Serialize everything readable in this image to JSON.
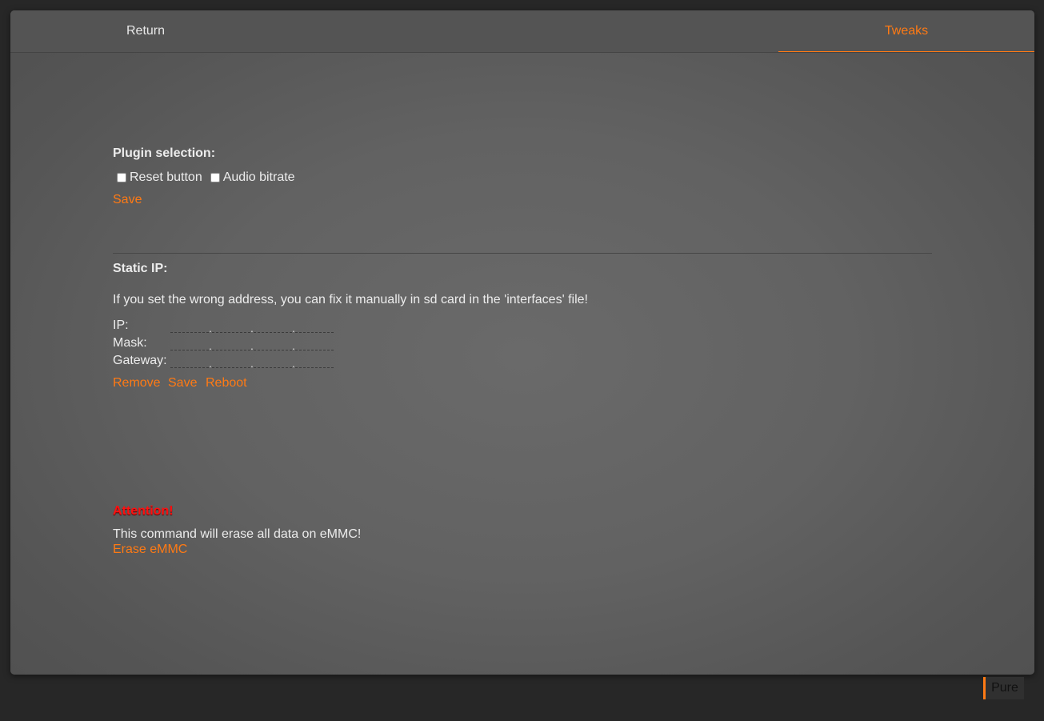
{
  "nav": {
    "return_label": "Return",
    "tweaks_label": "Tweaks"
  },
  "plugins": {
    "title": "Plugin selection:",
    "options": [
      "Reset button",
      "Audio bitrate"
    ],
    "save_label": "Save"
  },
  "static_ip": {
    "title": "Static IP:",
    "note": "If you set the wrong address, you can fix it manually in sd card in the 'interfaces' file!",
    "fields": [
      "IP:",
      "Mask:",
      "Gateway:"
    ],
    "separator": ".",
    "actions": {
      "remove": "Remove",
      "save": "Save",
      "reboot": "Reboot"
    }
  },
  "erase": {
    "attention": "Attention!",
    "warning": "This command will erase all data on eMMC!",
    "button_label": "Erase eMMC"
  },
  "theme": {
    "label": "Pure"
  },
  "colors": {
    "accent": "#ff7a14",
    "danger": "#ff1010",
    "page_bg": "#272727"
  }
}
